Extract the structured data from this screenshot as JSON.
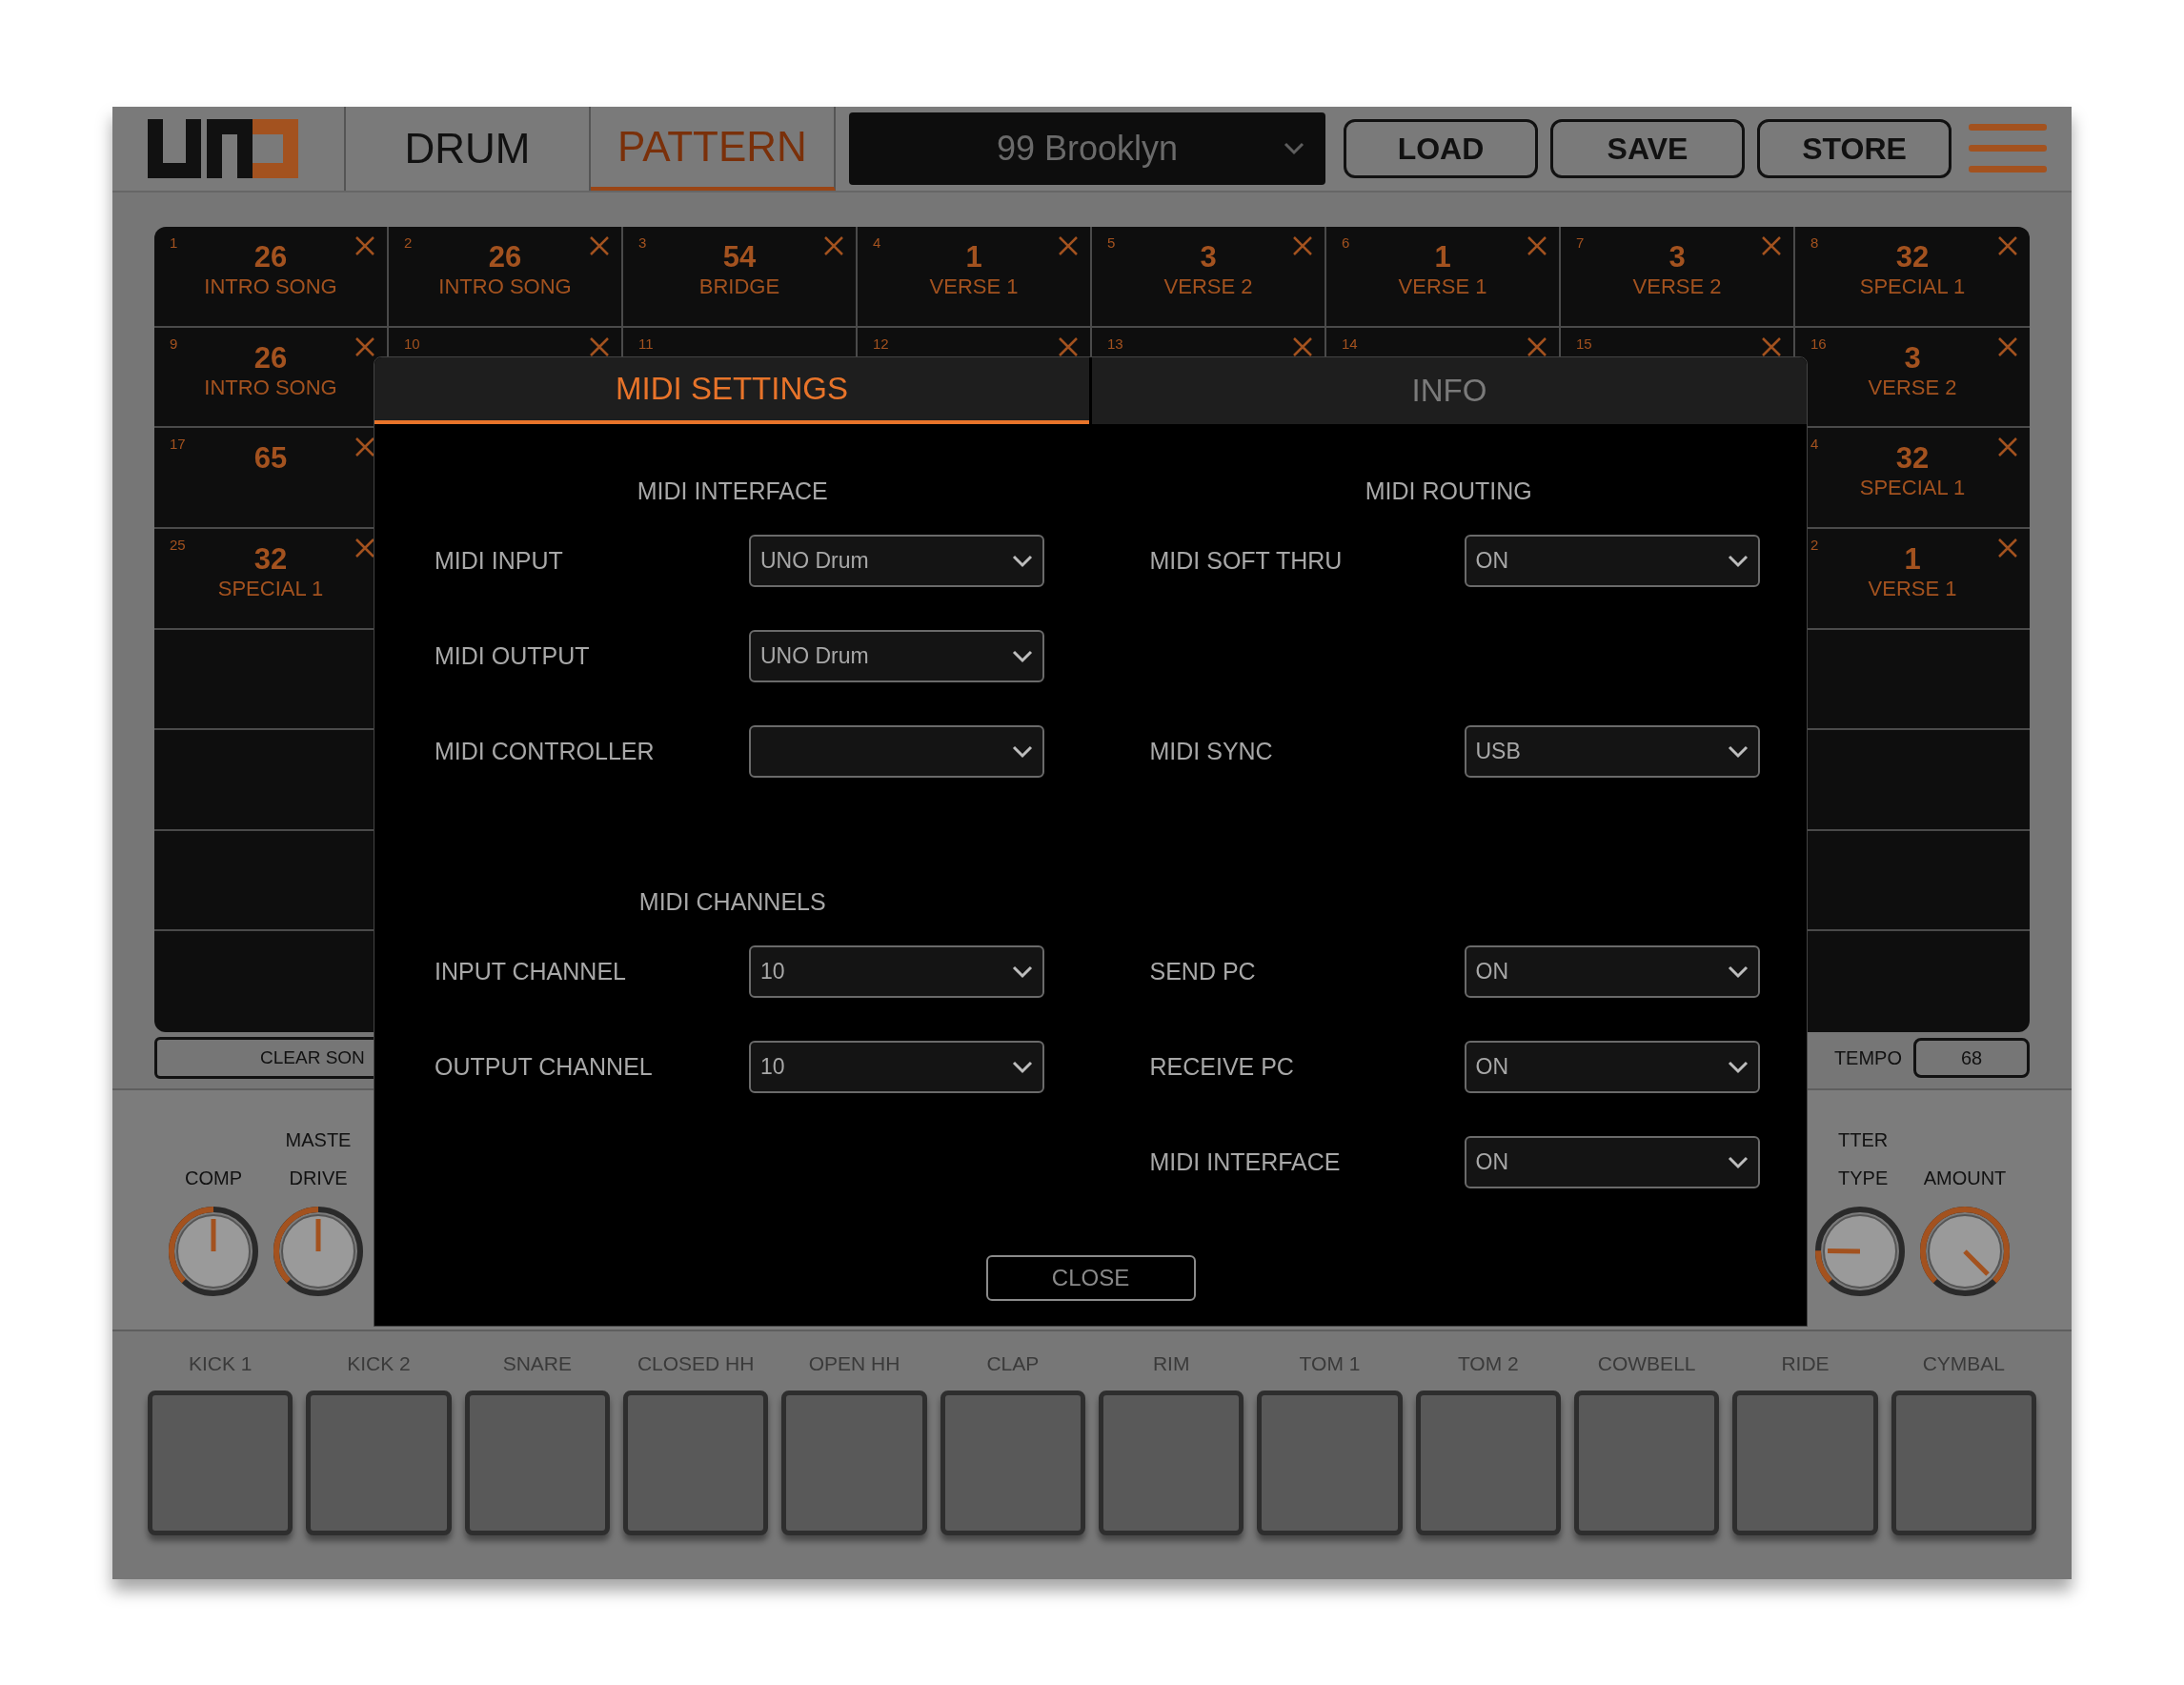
{
  "header": {
    "tabs": [
      {
        "label": "DRUM",
        "selected": false
      },
      {
        "label": "PATTERN",
        "selected": true
      }
    ],
    "preset": "99 Brooklyn",
    "buttons": [
      "LOAD",
      "SAVE",
      "STORE"
    ]
  },
  "grid": {
    "rows": [
      [
        {
          "number": "1",
          "value": "26",
          "name": "INTRO SONG",
          "removable": true
        },
        {
          "number": "2",
          "value": "26",
          "name": "INTRO SONG",
          "removable": true
        },
        {
          "number": "3",
          "value": "54",
          "name": "BRIDGE",
          "removable": true
        },
        {
          "number": "4",
          "value": "1",
          "name": "VERSE 1",
          "removable": true
        },
        {
          "number": "5",
          "value": "3",
          "name": "VERSE 2",
          "removable": true
        },
        {
          "number": "6",
          "value": "1",
          "name": "VERSE 1",
          "removable": true
        },
        {
          "number": "7",
          "value": "3",
          "name": "VERSE 2",
          "removable": true
        },
        {
          "number": "8",
          "value": "32",
          "name": "SPECIAL 1",
          "removable": true
        }
      ],
      [
        {
          "number": "9",
          "value": "26",
          "name": "INTRO SONG",
          "removable": true
        },
        {
          "number": "10",
          "removable": true
        },
        {
          "number": "11",
          "removable": false
        },
        {
          "number": "12",
          "removable": true
        },
        {
          "number": "13",
          "removable": true
        },
        {
          "number": "14",
          "removable": true
        },
        {
          "number": "15",
          "removable": true
        },
        {
          "number": "16",
          "value": "3",
          "name": "VERSE 2",
          "removable": true
        }
      ],
      [
        {
          "number": "17",
          "value": "65",
          "removable": true
        },
        {},
        {},
        {},
        {},
        {},
        {},
        {
          "number": "4",
          "value": "32",
          "name": "SPECIAL 1",
          "removable": true
        }
      ],
      [
        {
          "number": "25",
          "value": "32",
          "name": "SPECIAL 1",
          "removable": true
        },
        {},
        {},
        {},
        {},
        {},
        {},
        {
          "number": "2",
          "value": "1",
          "name": "VERSE 1",
          "removable": true
        }
      ]
    ]
  },
  "clear_button": "CLEAR SON",
  "tempo": {
    "label": "TEMPO",
    "value": "68"
  },
  "knobs_left": [
    {
      "label": "COMP",
      "level": 0.5
    },
    {
      "group": "MASTE",
      "label": "DRIVE",
      "level": 0.5
    }
  ],
  "knobs_right": [
    {
      "group": "TTER",
      "label": "TYPE",
      "level": 0.17
    },
    {
      "label": "AMOUNT",
      "level": 1
    }
  ],
  "pads": [
    "KICK 1",
    "KICK 2",
    "SNARE",
    "CLOSED HH",
    "OPEN HH",
    "CLAP",
    "RIM",
    "TOM 1",
    "TOM 2",
    "COWBELL",
    "RIDE",
    "CYMBAL"
  ],
  "dialog": {
    "tabs": [
      {
        "label": "MIDI SETTINGS",
        "selected": true
      },
      {
        "label": "INFO",
        "selected": false
      }
    ],
    "sections": [
      {
        "headings": [
          "MIDI INTERFACE",
          "MIDI ROUTING"
        ],
        "rows": [
          {
            "left": {
              "label": "MIDI INPUT",
              "value": "UNO Drum"
            },
            "right": {
              "label": "MIDI SOFT THRU",
              "value": "ON"
            }
          },
          {
            "left": {
              "label": "MIDI OUTPUT",
              "value": "UNO Drum"
            }
          },
          {
            "left": {
              "label": "MIDI CONTROLLER"
            },
            "right": {
              "label": "MIDI SYNC",
              "value": "USB"
            }
          }
        ]
      },
      {
        "headings": [
          "MIDI CHANNELS"
        ],
        "rows": [
          {
            "left": {
              "label": "INPUT CHANNEL",
              "value": "10"
            },
            "right": {
              "label": "SEND PC",
              "value": "ON"
            }
          },
          {
            "left": {
              "label": "OUTPUT CHANNEL",
              "value": "10"
            },
            "right": {
              "label": "RECEIVE PC",
              "value": "ON"
            }
          },
          {
            "right": {
              "label": "MIDI INTERFACE",
              "value": "ON"
            }
          }
        ]
      }
    ],
    "close": "CLOSE"
  }
}
